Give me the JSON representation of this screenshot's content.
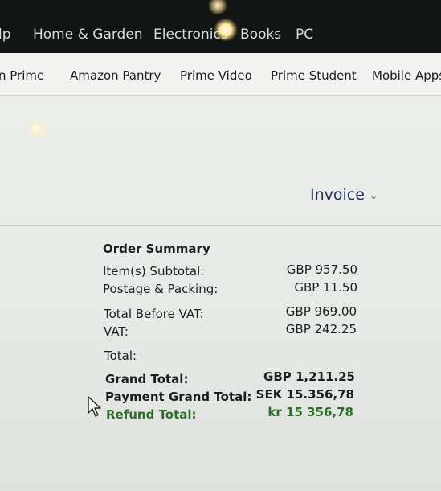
{
  "top_nav": {
    "items": [
      "lp",
      "Home & Garden",
      "Electronics",
      "Books",
      "PC"
    ]
  },
  "sub_nav": {
    "items": [
      "n Prime",
      "Amazon Pantry",
      "Prime Video",
      "Prime Student",
      "Mobile Apps"
    ]
  },
  "invoice": {
    "label": "Invoice",
    "chevron": "chevron-down-icon"
  },
  "order_summary": {
    "title": "Order Summary",
    "items_subtotal": {
      "label": "Item(s) Subtotal:",
      "value": "GBP 957.50"
    },
    "postage": {
      "label": "Postage & Packing:",
      "value": "GBP 11.50"
    },
    "total_before_vat": {
      "label": "Total Before VAT:",
      "value": "GBP 969.00"
    },
    "vat": {
      "label": "VAT:",
      "value": "GBP 242.25"
    },
    "total": {
      "label": "Total:",
      "value": ""
    },
    "grand_total": {
      "label": "Grand Total:",
      "value": "GBP 1,211.25"
    },
    "payment_grand_total": {
      "label": "Payment Grand Total:",
      "value": "SEK 15.356,78"
    },
    "refund_total": {
      "label": "Refund Total:",
      "value": "kr 15 356,78"
    }
  },
  "colors": {
    "nav_bg": "#131414",
    "invoice_link": "#22315a",
    "refund_green": "#2f6e2a"
  }
}
